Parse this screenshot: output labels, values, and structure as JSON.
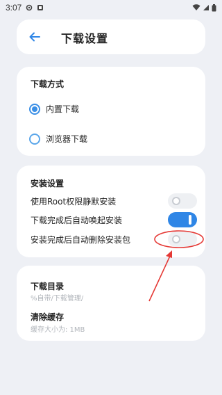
{
  "status_bar": {
    "time": "3:07",
    "icons": [
      "settings-icon",
      "notification-icon",
      "wifi-icon",
      "signal-icon",
      "battery-icon"
    ]
  },
  "header": {
    "back_icon": "arrow-left-icon",
    "title": "下载设置"
  },
  "download_method": {
    "title": "下载方式",
    "options": [
      {
        "label": "内置下载",
        "selected": true
      },
      {
        "label": "浏览器下载",
        "selected": false
      }
    ]
  },
  "install_settings": {
    "title": "安装设置",
    "toggles": [
      {
        "label": "使用Root权限静默安装",
        "on": false
      },
      {
        "label": "下载完成后自动唤起安装",
        "on": true
      },
      {
        "label": "安装完成后自动删除安装包",
        "on": false
      }
    ]
  },
  "storage": {
    "download_dir_title": "下载目录",
    "download_dir_value": "%自带/下载管理/",
    "clear_cache_title": "清除缓存",
    "cache_size": "缓存大小为: 1MB"
  },
  "colors": {
    "accent": "#2f86e6",
    "background": "#eef0f5",
    "annotation": "#e53935"
  }
}
